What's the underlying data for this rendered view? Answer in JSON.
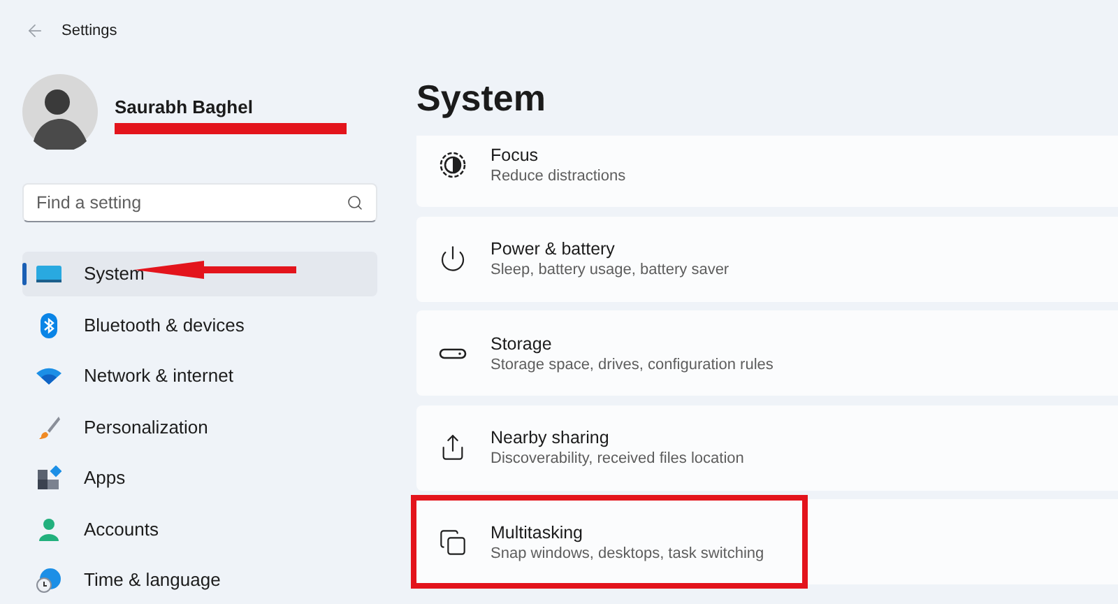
{
  "window": {
    "title": "Settings"
  },
  "profile": {
    "name": "Saurabh Baghel"
  },
  "search": {
    "placeholder": "Find a setting"
  },
  "sidebar": {
    "items": [
      {
        "label": "System",
        "selected": true
      },
      {
        "label": "Bluetooth & devices",
        "selected": false
      },
      {
        "label": "Network & internet",
        "selected": false
      },
      {
        "label": "Personalization",
        "selected": false
      },
      {
        "label": "Apps",
        "selected": false
      },
      {
        "label": "Accounts",
        "selected": false
      },
      {
        "label": "Time & language",
        "selected": false
      }
    ]
  },
  "page": {
    "title": "System",
    "items": [
      {
        "title": "Focus",
        "subtitle": "Reduce distractions"
      },
      {
        "title": "Power & battery",
        "subtitle": "Sleep, battery usage, battery saver"
      },
      {
        "title": "Storage",
        "subtitle": "Storage space, drives, configuration rules"
      },
      {
        "title": "Nearby sharing",
        "subtitle": "Discoverability, received files location"
      },
      {
        "title": "Multitasking",
        "subtitle": "Snap windows, desktops, task switching"
      }
    ]
  },
  "annotations": [
    {
      "kind": "redaction"
    },
    {
      "kind": "arrow"
    },
    {
      "kind": "highlight"
    }
  ]
}
